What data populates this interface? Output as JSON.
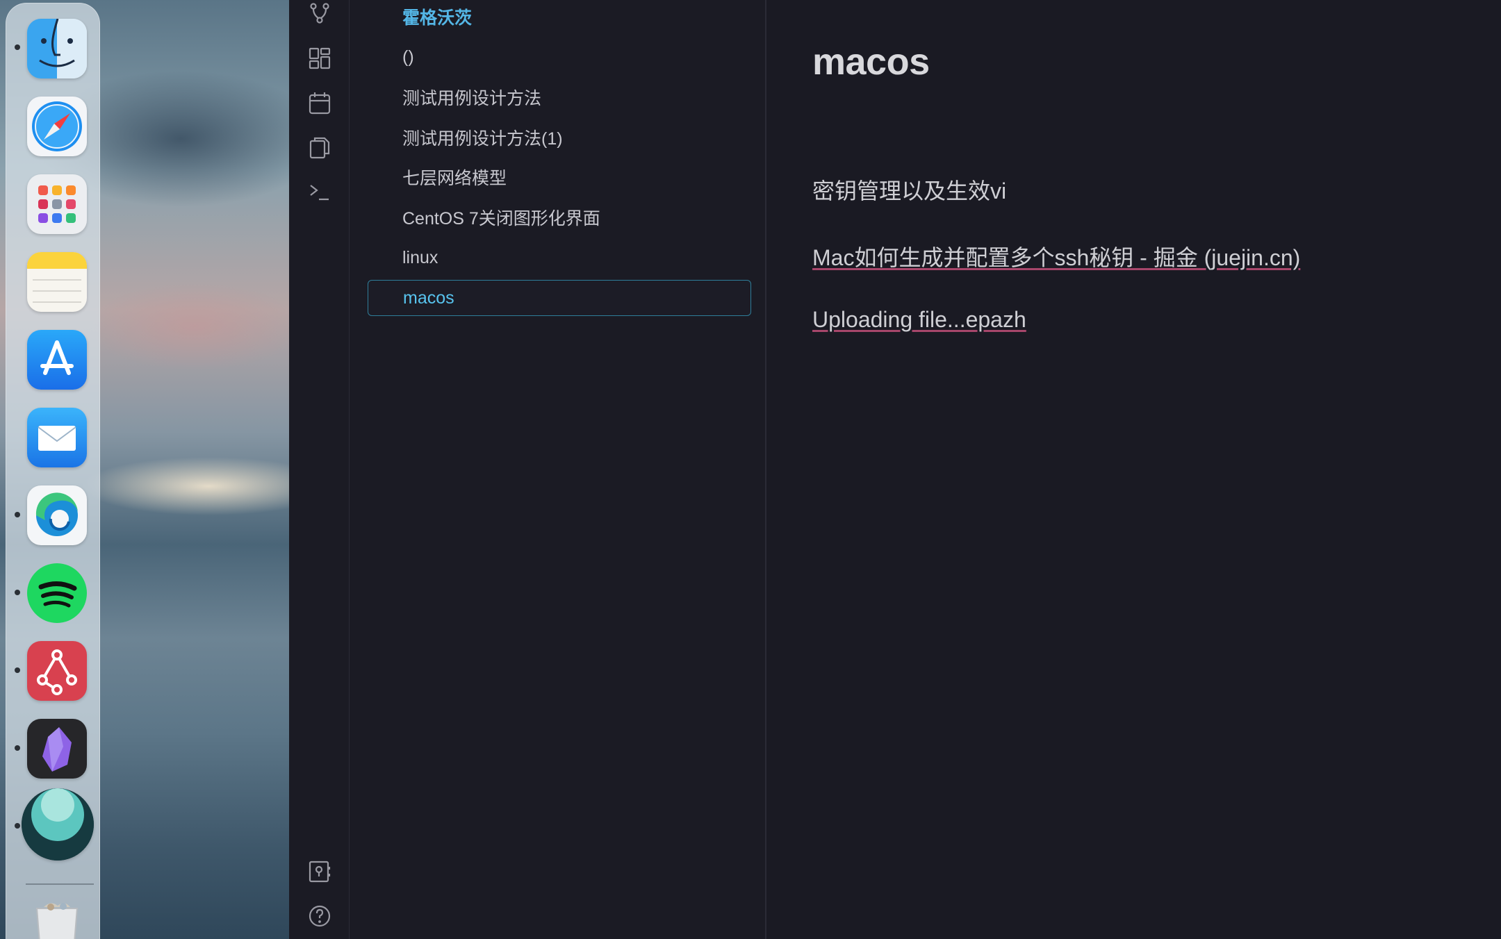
{
  "dock": {
    "apps": [
      {
        "name": "Finder",
        "icon": "finder-icon",
        "running": true
      },
      {
        "name": "Safari",
        "icon": "safari-icon",
        "running": false
      },
      {
        "name": "Launchpad",
        "icon": "launchpad-icon",
        "running": false
      },
      {
        "name": "Notes",
        "icon": "notes-icon",
        "running": false
      },
      {
        "name": "App Store",
        "icon": "app-store-icon",
        "running": false
      },
      {
        "name": "Mail",
        "icon": "mail-icon",
        "running": false
      },
      {
        "name": "Microsoft Edge",
        "icon": "edge-icon",
        "running": true
      },
      {
        "name": "Spotify",
        "icon": "spotify-icon",
        "running": true
      },
      {
        "name": "Git client",
        "icon": "git-client-icon",
        "running": true
      },
      {
        "name": "Obsidian",
        "icon": "obsidian-icon",
        "running": true
      },
      {
        "name": "Teal app",
        "icon": "teal-circle-icon",
        "running": true
      },
      {
        "name": "Trash",
        "icon": "trash-icon",
        "running": false
      }
    ]
  },
  "ribbon": {
    "top_icons": [
      "graph-view-icon",
      "canvas-grid-icon",
      "calendar-icon",
      "copy-files-icon",
      "terminal-icon"
    ],
    "bottom_icons": [
      "vault-switch-icon",
      "help-icon"
    ]
  },
  "file_list": {
    "items": [
      {
        "label": "霍格沃茨",
        "type": "folder"
      },
      {
        "label": "()",
        "type": "file"
      },
      {
        "label": "测试用例设计方法",
        "type": "file"
      },
      {
        "label": "测试用例设计方法(1)",
        "type": "file"
      },
      {
        "label": "七层网络模型",
        "type": "file"
      },
      {
        "label": "CentOS 7关闭图形化界面",
        "type": "file"
      },
      {
        "label": "linux",
        "type": "file"
      },
      {
        "label": "macos",
        "type": "file",
        "active": true
      }
    ]
  },
  "editor": {
    "title": "macos",
    "line1": "密钥管理以及生效vi",
    "link_text": "Mac如何生成并配置多个ssh秘钥 - 掘金 (juejin.cn)",
    "upload_text": "Uploading file...epazh"
  },
  "colors": {
    "accent": "#54b6e6",
    "active_border": "#2f7e9a",
    "link_underline": "#a7466b",
    "background": "#1a1a23"
  }
}
